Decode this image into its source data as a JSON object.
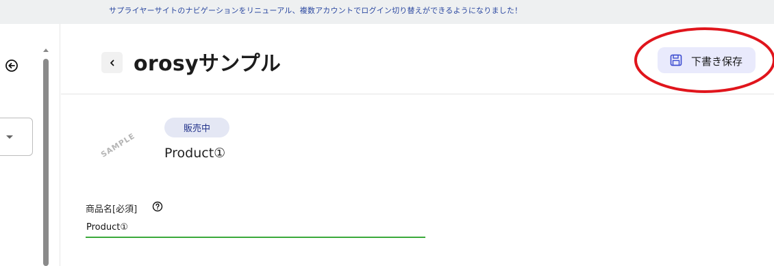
{
  "banner": {
    "text": "サプライヤーサイトのナビゲーションをリニューアル、複数アカウントでログイン切り替えができるようになりました！"
  },
  "sidebar": {
    "back_icon": "circle-arrow-left-icon",
    "select_caret_icon": "caret-down-icon"
  },
  "header": {
    "back_icon": "chevron-left-icon",
    "title": "orosyサンプル",
    "save_button": {
      "label": "下書き保存",
      "icon": "save-icon"
    }
  },
  "annotation": {
    "color": "#e0151c"
  },
  "product": {
    "thumbnail_text": "SAMPLE",
    "status": "販売中",
    "name": "Product①"
  },
  "form": {
    "name_field": {
      "label": "商品名[必須]",
      "help_icon": "help-circle-icon",
      "value": "Product①"
    }
  },
  "colors": {
    "accent": "#22328a",
    "save_bg": "#e9eafc",
    "input_underline": "#3aa93a",
    "banner_text": "#2a47a0"
  }
}
